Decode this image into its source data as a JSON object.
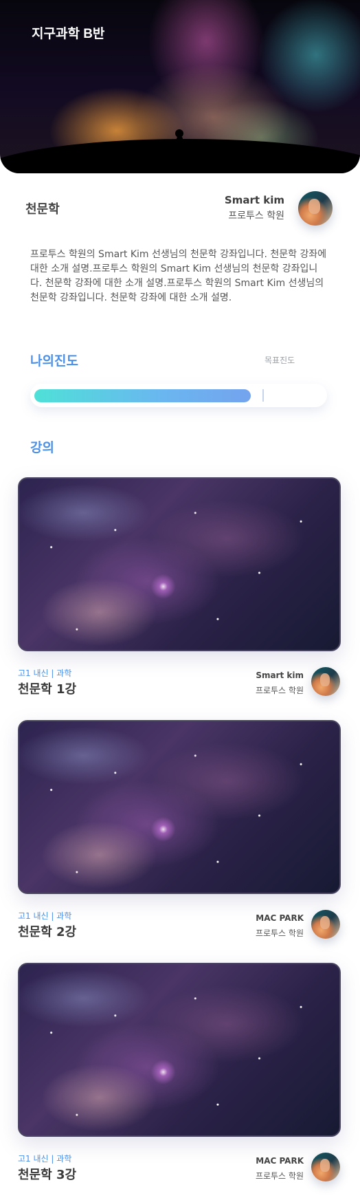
{
  "hero": {
    "title": "지구과학 B반"
  },
  "course": {
    "title": "천문학",
    "teacher_name": "Smart kim",
    "academy": "프로투스 학원",
    "description": "프로투스 학원의 Smart Kim 선생님의 천문학 강좌입니다. 천문학 강좌에 대한 소개 설명.프로투스 학원의 Smart Kim 선생님의 천문학 강좌입니다. 천문학 강좌에 대한 소개 설명.프로투스 학원의 Smart Kim 선생님의 천문학 강좌입니다. 천문학 강좌에 대한 소개 설명."
  },
  "progress": {
    "title": "나의진도",
    "goal_label": "목표진도",
    "my_progress": 0.75,
    "goal_progress": 0.79
  },
  "lectures_heading": "강의",
  "lectures": [
    {
      "category": "고1 내신 | 과학",
      "title": "천문학 1강",
      "teacher": "Smart kim",
      "academy": "프로투스 학원"
    },
    {
      "category": "고1 내신 | 과학",
      "title": "천문학 2강",
      "teacher": "MAC PARK",
      "academy": "프로투스 학원"
    },
    {
      "category": "고1 내신 | 과학",
      "title": "천문학 3강",
      "teacher": "MAC PARK",
      "academy": "프로투스 학원"
    }
  ],
  "colors": {
    "accent": "#4a8fe8",
    "progress_start": "#4fe0d8",
    "progress_end": "#74a3ee"
  }
}
